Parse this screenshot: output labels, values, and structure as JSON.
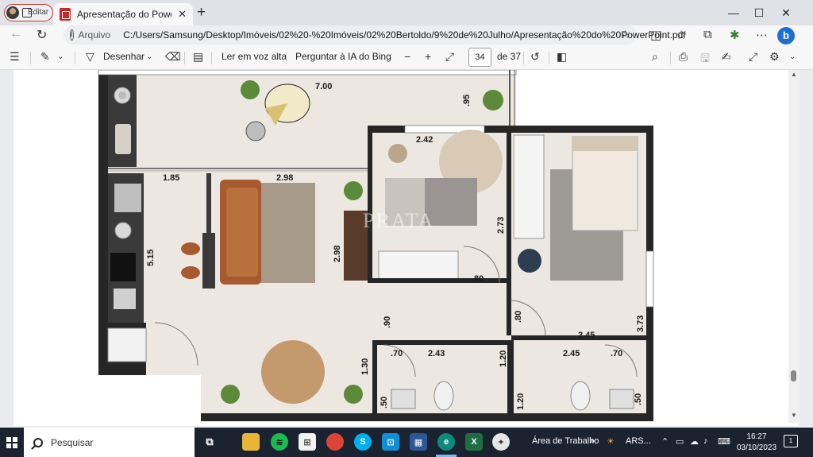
{
  "profile": {
    "label": "Editar"
  },
  "tab": {
    "title": "Apresentação do PowerPoint.pdf",
    "close": "✕"
  },
  "window_controls": {
    "minimize": "—",
    "maximize": "☐",
    "close": "✕"
  },
  "address_bar": {
    "site_label": "Arquivo",
    "url": "C:/Users/Samsung/Desktop/Imóveis/02%20-%20Imóveis/02%20Bertoldo/9%20de%20Julho/Apresentação%20do%20PowerPoint.pdf"
  },
  "pdf_toolbar": {
    "draw_label": "Desenhar",
    "read_aloud_label": "Ler em voz alta",
    "ask_bing_label": "Perguntar à IA do Bing",
    "current_page": "34",
    "total_pages": "de 37"
  },
  "floor_plan": {
    "watermark": "PRATA",
    "dimensions": {
      "balcony_width": "7.00",
      "balcony_depth": ".95",
      "bedroom2_width": "2.42",
      "bedroom2_depth": "2.73",
      "kitchen_width": "1.85",
      "living_width": "2.98",
      "living_height": "2.98",
      "left_height": "5.15",
      "door_bedroom2": ".80",
      "door_master": ".80",
      "hall_width": ".90",
      "master_width": "2.45",
      "master_depth": "3.73",
      "bath1_door": ".70",
      "bath1_width": "2.43",
      "bath1_depth": "1.20",
      "bath2_width": "2.45",
      "bath2_door": ".70",
      "bath2_depth": "1.20",
      "dining_height": "1.30",
      "bath1_sink": ".50",
      "bath2_sink": ".50"
    }
  },
  "taskbar": {
    "search_placeholder": "Pesquisar",
    "desktop_label": "Área de Trabalho",
    "weather_label": "ARS...",
    "time": "16:27",
    "date": "03/10/2023",
    "notification_count": "1"
  },
  "icons": {
    "back": "←",
    "refresh": "↻",
    "info": "i",
    "favorite": "☆",
    "split": "◫",
    "favorites": "✩",
    "collections": "⧉",
    "extensions": "✱",
    "more": "⋯",
    "bing": "b",
    "toc": "☰",
    "highlight": "✎",
    "draw": "▽",
    "erase": "⌫",
    "view": "▤",
    "zoom_out": "−",
    "zoom_in": "+",
    "fit": "⤢",
    "rotate": "↺",
    "two_page": "◧",
    "search": "⌕",
    "print": "⎙",
    "save": "🖫",
    "save_as": "✍",
    "fullscreen": "⤢",
    "settings": "⚙",
    "pin": "⌄"
  }
}
